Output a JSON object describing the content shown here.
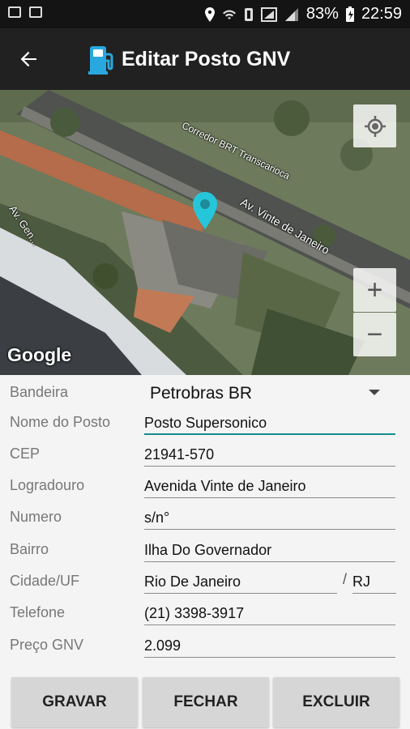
{
  "status_bar": {
    "battery": "83%",
    "time": "22:59"
  },
  "app_bar": {
    "title": "Editar Posto GNV",
    "back_icon": "back-arrow-icon",
    "logo_icon": "fuel-pump-icon"
  },
  "map": {
    "labels": [
      "Corredor BRT Transcarioca",
      "Av. Vinte de Janeiro",
      "Av. Gen..."
    ],
    "attribution": "Google",
    "zoom_in_label": "+",
    "zoom_out_label": "−",
    "marker_color": "#26c6da"
  },
  "form": {
    "bandeira": {
      "label": "Bandeira",
      "value": "Petrobras BR"
    },
    "nome": {
      "label": "Nome do Posto",
      "value": "Posto Supersonico"
    },
    "cep": {
      "label": "CEP",
      "value": "21941-570"
    },
    "logradouro": {
      "label": "Logradouro",
      "value": "Avenida Vinte de Janeiro"
    },
    "numero": {
      "label": "Numero",
      "value": "s/n°"
    },
    "bairro": {
      "label": "Bairro",
      "value": "Ilha Do Governador"
    },
    "cidade": {
      "label": "Cidade/UF",
      "value": "Rio De Janeiro",
      "uf_separator": "/",
      "uf": "RJ"
    },
    "telefone": {
      "label": "Telefone",
      "value": "(21) 3398-3917"
    },
    "preco": {
      "label": "Preço GNV",
      "value": "2.099"
    }
  },
  "buttons": {
    "save": "GRAVAR",
    "close": "FECHAR",
    "delete": "EXCLUIR"
  }
}
